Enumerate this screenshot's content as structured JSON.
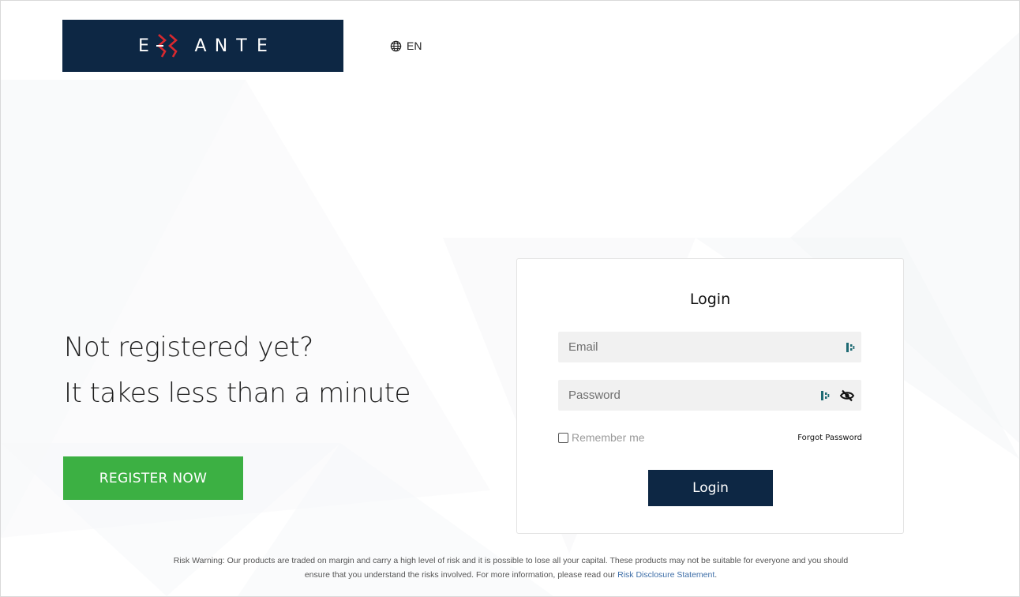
{
  "brand": {
    "logo_letters": [
      "E",
      "A",
      "N",
      "T",
      "E"
    ],
    "colors": {
      "navy": "#0d2744",
      "accent_red": "#d8292f",
      "register_green": "#3cb043"
    }
  },
  "header": {
    "language": "EN",
    "language_icon": "globe-icon"
  },
  "promo": {
    "line1": "Not registered yet?",
    "line2": "It takes less than a minute",
    "register_button": "REGISTER NOW"
  },
  "login": {
    "title": "Login",
    "email_placeholder": "Email",
    "email_value": "",
    "password_placeholder": "Password",
    "password_value": "",
    "autofill_icon": "password-manager-icon",
    "visibility_icon": "eye-slash-icon",
    "remember_label": "Remember me",
    "remember_checked": false,
    "forgot_label": "Forgot Password",
    "submit_label": "Login"
  },
  "footer": {
    "risk_text_line1": "Risk Warning: Our products are traded on margin and carry a high level of risk and it is possible to lose all your capital. These products may not be suitable for everyone and you should",
    "risk_text_line2": "ensure that you understand the risks involved. For more information, please read our",
    "risk_link": "Risk Disclosure Statement",
    "risk_end": "."
  }
}
